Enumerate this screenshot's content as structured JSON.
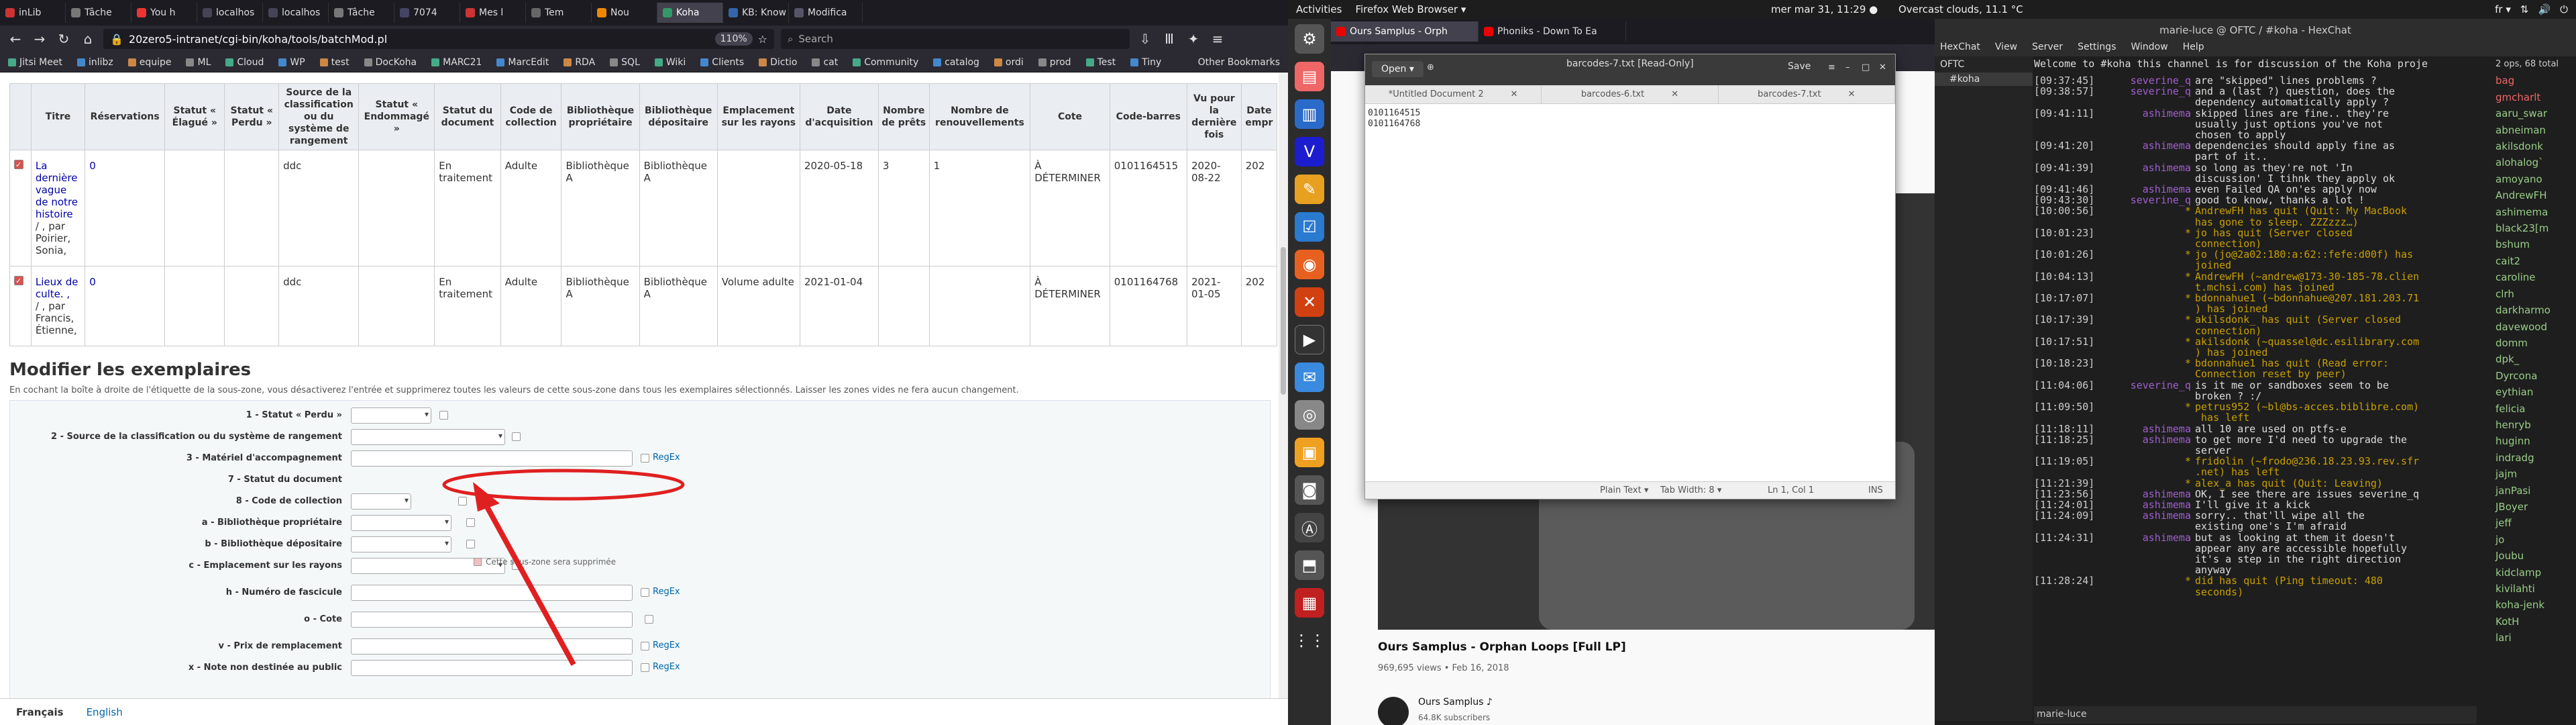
{
  "browser_left": {
    "tabs": [
      "inLib",
      "Tâche",
      "You h",
      "localhos",
      "localhos",
      "Tâche",
      "7074",
      "Mes l",
      "Tem",
      "Nou",
      "Koha",
      "KB: Know",
      "Modifica"
    ],
    "url": "20zero5-intranet/cgi-bin/koha/tools/batchMod.pl",
    "zoom": "110%",
    "search_placeholder": "Search",
    "bookmarks": [
      "Jitsi Meet",
      "inlibz",
      "equipe",
      "ML",
      "Cloud",
      "WP",
      "test",
      "DocKoha",
      "MARC21",
      "MarcEdit",
      "RDA",
      "SQL",
      "Wiki",
      "Clients",
      "Dictio",
      "cat",
      "Community",
      "catalog",
      "ordi",
      "prod",
      "Test",
      "Tiny"
    ],
    "other_bookmarks": "Other Bookmarks"
  },
  "items_table": {
    "headers": [
      "",
      "Titre",
      "Réservations",
      "Statut « Élagué »",
      "Statut « Perdu »",
      "Source de la classification ou du système de rangement",
      "Statut « Endommagé »",
      "Statut du document",
      "Code de collection",
      "Bibliothèque propriétaire",
      "Bibliothèque dépositaire",
      "Emplacement sur les rayons",
      "Date d'acquisition",
      "Nombre de prêts",
      "Nombre de renouvellements",
      "Cote",
      "Code-barres",
      "Vu pour la dernière fois",
      "Date empr"
    ],
    "rows": [
      {
        "title": "La dernière vague de notre histoire",
        "author": "/ , par Poirier, Sonia,",
        "reservations": "0",
        "source": "ddc",
        "status": "En traitement",
        "collection": "Adulte",
        "home": "Bibliothèque A",
        "holding": "Bibliothèque A",
        "location": "",
        "acquired": "2020-05-18",
        "issues": "3",
        "renewals": "1",
        "callnumber": "À DÉTERMINER",
        "barcode": "0101164515",
        "seen": "2020-08-22",
        "due": "202"
      },
      {
        "title": "Lieux de culte. ,",
        "author": "/ , par Francis, Étienne,",
        "reservations": "0",
        "source": "ddc",
        "status": "En traitement",
        "collection": "Adulte",
        "home": "Bibliothèque A",
        "holding": "Bibliothèque A",
        "location": "Volume adulte",
        "acquired": "2021-01-04",
        "issues": "",
        "renewals": "",
        "callnumber": "À DÉTERMINER",
        "barcode": "0101164768",
        "seen": "2021-01-05",
        "due": "202"
      }
    ]
  },
  "modify": {
    "title": "Modifier les exemplaires",
    "help": "En cochant la boîte à droite de l'étiquette de la sous-zone, vous désactiverez l'entrée et supprimerez toutes les valeurs de cette sous-zone dans tous les exemplaires sélectionnés. Laisser les zones vides ne fera aucun changement.",
    "fields": [
      {
        "label": "1 - Statut « Perdu »",
        "type": "select",
        "regex": ""
      },
      {
        "label": "2 - Source de la classification ou du système de rangement",
        "type": "select",
        "regex": ""
      },
      {
        "label": "3 - Matériel d'accompagnement",
        "type": "text",
        "regex": "RegEx"
      },
      {
        "label": "7 - Statut du document",
        "type": "none",
        "regex": ""
      },
      {
        "label": "8 - Code de collection",
        "type": "select",
        "regex": ""
      },
      {
        "label": "a - Bibliothèque propriétaire",
        "type": "select",
        "regex": ""
      },
      {
        "label": "b - Bibliothèque dépositaire",
        "type": "select",
        "regex": ""
      },
      {
        "label": "c - Emplacement sur les rayons",
        "type": "select",
        "regex": ""
      },
      {
        "label": "h - Numéro de fascicule",
        "type": "text",
        "regex": "RegEx"
      },
      {
        "label": "o - Cote",
        "type": "text",
        "regex": ""
      },
      {
        "label": "v - Prix de remplacement",
        "type": "text",
        "regex": "RegEx"
      },
      {
        "label": "x - Note non destinée au public",
        "type": "text",
        "regex": "RegEx"
      }
    ],
    "deleted_note": "Cette sous-zone sera supprimée"
  },
  "languages": {
    "current": "Français",
    "other": "English"
  },
  "desktop": {
    "activities": "Activities",
    "app": "Firefox Web Browser ▾",
    "clock": "mer mar 31, 11:29 ●",
    "weather": "Overcast clouds, 11.1 °C",
    "lang": "fr ▾"
  },
  "youtube": {
    "tabs": [
      "Ours Samplus - Orph",
      "Phoniks - Down To Ea"
    ],
    "title": "Ours Samplus - Orphan Loops [Full LP]",
    "meta": "969,695 views • Feb 16, 2018",
    "channel": "Ours Samplus ♪",
    "subs": "64.8K subscribers"
  },
  "gedit": {
    "open": "Open ▾",
    "title": "barcodes-7.txt [Read-Only]",
    "save": "Save",
    "tabs": [
      "*Untitled Document 2",
      "barcodes-6.txt",
      "barcodes-7.txt"
    ],
    "text": "0101164515\n0101164768",
    "status": {
      "mode": "Plain Text ▾",
      "tab": "Tab Width: 8 ▾",
      "pos": "Ln 1, Col 1",
      "ins": "INS"
    }
  },
  "hexchat": {
    "title": "marie-luce @ OFTC / #koha - HexChat",
    "menu": [
      "HexChat",
      "View",
      "Server",
      "Settings",
      "Window",
      "Help"
    ],
    "tree": [
      "OFTC",
      "#koha"
    ],
    "topic": "Welcome to #koha this channel is for discussion of the Koha proje",
    "ops": "2 ops, 68 total",
    "log": [
      {
        "t": "[09:37:45]",
        "n": "severine_q",
        "m": "are \"skipped\" lines problems ?",
        "s": false
      },
      {
        "t": "[09:38:57]",
        "n": "severine_q",
        "m": "and a (last ?) question, does the\ndependency automatically apply ?",
        "s": false
      },
      {
        "t": "[09:41:11]",
        "n": "ashimema",
        "m": "skipped lines are fine.. they're\nusually just options you've not\nchosen to apply",
        "s": false
      },
      {
        "t": "[09:41:20]",
        "n": "ashimema",
        "m": "dependencies should apply fine as\npart of it..",
        "s": false
      },
      {
        "t": "[09:41:39]",
        "n": "ashimema",
        "m": "so long as they're not 'In\ndiscussion' I tihnk they apply ok",
        "s": false
      },
      {
        "t": "[09:41:46]",
        "n": "ashimema",
        "m": "even Failed QA on'es apply now",
        "s": false
      },
      {
        "t": "[09:43:30]",
        "n": "severine_q",
        "m": "good to know, thanks a lot !",
        "s": false
      },
      {
        "t": "[10:00:56]",
        "n": "*",
        "m": "AndrewFH has quit (Quit: My MacBook\nhas gone to sleep. ZZZzzz…)",
        "s": true
      },
      {
        "t": "[10:01:23]",
        "n": "*",
        "m": "jo has quit (Server closed\nconnection)",
        "s": true
      },
      {
        "t": "[10:01:26]",
        "n": "*",
        "m": "jo (jo@2a02:180:a:62::fefe:d00f) has\njoined",
        "s": true
      },
      {
        "t": "[10:04:13]",
        "n": "*",
        "m": "AndrewFH (~andrew@173-30-185-78.clien\nt.mchsi.com) has joined",
        "s": true
      },
      {
        "t": "[10:17:07]",
        "n": "*",
        "m": "bdonnahue1 (~bdonnahue@207.181.203.71\n) has joined",
        "s": true
      },
      {
        "t": "[10:17:39]",
        "n": "*",
        "m": "akilsdonk_ has quit (Server closed\nconnection)",
        "s": true
      },
      {
        "t": "[10:17:51]",
        "n": "*",
        "m": "akilsdonk (~quassel@dc.esilibrary.com\n) has joined",
        "s": true
      },
      {
        "t": "[10:18:23]",
        "n": "*",
        "m": "bdonnahue1 has quit (Read error:\nConnection reset by peer)",
        "s": true
      },
      {
        "t": "[11:04:06]",
        "n": "severine_q",
        "m": "is it me or sandboxes seem to be\nbroken ? :/",
        "s": false
      },
      {
        "t": "[11:09:50]",
        "n": "*",
        "m": "petrus952 (~bl@bs-acces.biblibre.com)\n has left",
        "s": true
      },
      {
        "t": "[11:18:11]",
        "n": "ashimema",
        "m": "all 10 are used on ptfs-e",
        "s": false
      },
      {
        "t": "[11:18:25]",
        "n": "ashimema",
        "m": "to get more I'd need to upgrade the\nserver",
        "s": false
      },
      {
        "t": "[11:19:05]",
        "n": "*",
        "m": "fridolin (~frodo@236.18.23.93.rev.sfr\n.net) has left",
        "s": true
      },
      {
        "t": "[11:21:39]",
        "n": "*",
        "m": "alex_a has quit (Quit: Leaving)",
        "s": true
      },
      {
        "t": "[11:23:56]",
        "n": "ashimema",
        "m": "OK, I see there are issues severine_q",
        "s": false
      },
      {
        "t": "[11:24:01]",
        "n": "ashimema",
        "m": "I'll give it a kick",
        "s": false
      },
      {
        "t": "[11:24:09]",
        "n": "ashimema",
        "m": "sorry.. that'll wipe all the\nexisting one's I'm afraid",
        "s": false
      },
      {
        "t": "[11:24:31]",
        "n": "ashimema",
        "m": "but as looking at them it doesn't\nappear any are accessible hopefully\nit's a step in the right direction\nanyway",
        "s": false
      },
      {
        "t": "[11:28:24]",
        "n": "*",
        "m": "did has quit (Ping timeout: 480\nseconds)",
        "s": true
      }
    ],
    "users": [
      "bag",
      "gmcharlt",
      "aaru_swar",
      "abneiman",
      "akilsdonk",
      "alohalog`",
      "amoyano",
      "AndrewFH",
      "ashimema",
      "black23[m",
      "bshum",
      "cait2",
      "caroline",
      "clrh",
      "darkharmo",
      "davewood",
      "domm",
      "dpk_",
      "Dyrcona",
      "eythian",
      "felicia",
      "henryb",
      "huginn",
      "indradg",
      "jajm",
      "janPasi",
      "JBoyer",
      "jeff",
      "jo",
      "Joubu",
      "kidclamp",
      "kivilahti",
      "koha-jenk",
      "KotH",
      "lari"
    ],
    "input_nick": "marie-luce"
  }
}
